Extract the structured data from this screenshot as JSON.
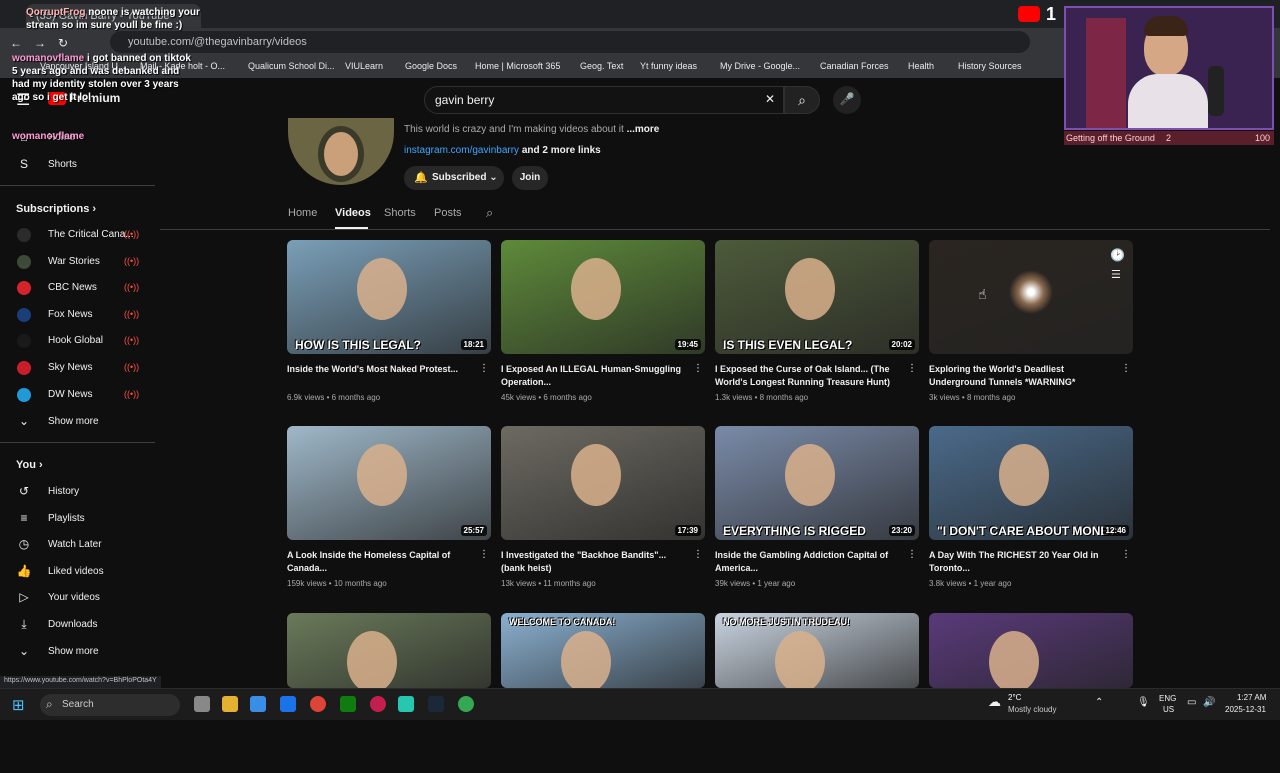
{
  "browser": {
    "tab_title": "(35) Gavin Barry - YouTube",
    "url": "youtube.com/@thegavinbarry/videos",
    "bookmarks": [
      "Vancouver Island U...",
      "Mail - Kade holt - O...",
      "Qualicum School Di...",
      "VIULearn",
      "Google Docs",
      "Home | Microsoft 365",
      "Geog. Text",
      "Yt funny ideas",
      "My Drive - Google...",
      "Canadian Forces",
      "Health",
      "History Sources"
    ],
    "status_url": "https://www.youtube.com/watch?v=BhPloPOta4Y"
  },
  "yt": {
    "logo_text": "Premium",
    "search_value": "gavin berry",
    "clear_glyph": "✕",
    "search_glyph": "⌕",
    "mic_glyph": "🎤"
  },
  "sidebar": {
    "home": "Home",
    "shorts": "Shorts",
    "subscriptions_label": "Subscriptions",
    "subs": [
      {
        "name": "The Critical Cana...",
        "color": "#2b2b2b"
      },
      {
        "name": "War Stories",
        "color": "#3d4a3a"
      },
      {
        "name": "CBC News",
        "color": "#d4232a"
      },
      {
        "name": "Fox News",
        "color": "#1b3d7a"
      },
      {
        "name": "Hook Global",
        "color": "#1a1a1a"
      },
      {
        "name": "Sky News",
        "color": "#c81e2b"
      },
      {
        "name": "DW News",
        "color": "#1f9ad6"
      }
    ],
    "show_more": "Show more",
    "you_label": "You",
    "you_items": [
      "History",
      "Playlists",
      "Watch Later",
      "Liked videos",
      "Your videos",
      "Downloads",
      "Show more"
    ]
  },
  "channel": {
    "description": "This world is crazy and I'm making videos about it",
    "more": "...more",
    "link": "instagram.com/gavinbarry",
    "more_links": "and 2 more links",
    "subscribed": "Subscribed",
    "join": "Join",
    "tabs": [
      "Home",
      "Videos",
      "Shorts",
      "Posts"
    ]
  },
  "videos": [
    {
      "title": "Inside the World's Most Naked Protest...",
      "views": "6.9k views",
      "age": "6 months ago",
      "duration": "18:21",
      "overlay": "HOW IS THIS LEGAL?",
      "bg": "#7a9fb8"
    },
    {
      "title": "I Exposed An ILLEGAL Human-Smuggling Operation...",
      "views": "45k views",
      "age": "6 months ago",
      "duration": "19:45",
      "overlay": "",
      "bg": "#5e8a3a"
    },
    {
      "title": "I Exposed the Curse of Oak Island... (The World's Longest Running Treasure Hunt)",
      "views": "1.3k views",
      "age": "8 months ago",
      "duration": "20:02",
      "overlay": "IS THIS EVEN LEGAL?",
      "bg": "#4d5a3a"
    },
    {
      "title": "Exploring the World's Deadliest Underground Tunnels *WARNING*",
      "views": "3k views",
      "age": "8 months ago",
      "duration": "",
      "overlay": "",
      "bg": "#2a2520"
    },
    {
      "title": "A Look Inside the Homeless Capital of Canada...",
      "views": "159k views",
      "age": "10 months ago",
      "duration": "25:57",
      "overlay": "",
      "bg": "#9fb8c9"
    },
    {
      "title": "I Investigated the \"Backhoe Bandits\"... (bank heist)",
      "views": "13k views",
      "age": "11 months ago",
      "duration": "17:39",
      "overlay": "",
      "bg": "#6d6a62"
    },
    {
      "title": "Inside the Gambling Addiction Capital of America...",
      "views": "39k views",
      "age": "1 year ago",
      "duration": "23:20",
      "overlay": "EVERYTHING IS RIGGED",
      "bg": "#7a8ba8"
    },
    {
      "title": "A Day With The RICHEST 20 Year Old in Toronto...",
      "views": "3.8k views",
      "age": "1 year ago",
      "duration": "12:46",
      "overlay": "\"I DON'T CARE ABOUT MONEY\"",
      "bg": "#4a6a8a"
    },
    {
      "title": "",
      "views": "",
      "age": "",
      "duration": "",
      "overlay": "",
      "bg": "#6a7a5a"
    },
    {
      "title": "",
      "views": "",
      "age": "",
      "duration": "",
      "overlay": "WELCOME TO CANADA!",
      "bg": "#8ab0d0"
    },
    {
      "title": "",
      "views": "",
      "age": "",
      "duration": "",
      "overlay": "NO MORE JUSTIN TRUDEAU!",
      "bg": "#c9d4e0"
    },
    {
      "title": "",
      "views": "",
      "age": "",
      "duration": "",
      "overlay": "",
      "bg": "#5a3a7a"
    }
  ],
  "taskbar": {
    "search": "Search",
    "weather_temp": "2°C",
    "weather_desc": "Mostly cloudy",
    "lang": "ENG",
    "region": "US",
    "time": "1:27 AM",
    "date": "2025-12-31"
  },
  "stream": {
    "chat_user1": "QorruptFrog",
    "chat_msg1": "noone is watching your stream so im sure youll be fine :)",
    "chat_user2": "womanovflame",
    "chat_msg2": "i got banned on tiktok 5 years ago and was debanked and had my identity stolen over 3 years ago so i get it lol",
    "chat_user3": "womanovflame",
    "goal_label": "Getting off the Ground",
    "goal_current": "2",
    "goal_target": "100",
    "yt_count": "1"
  }
}
